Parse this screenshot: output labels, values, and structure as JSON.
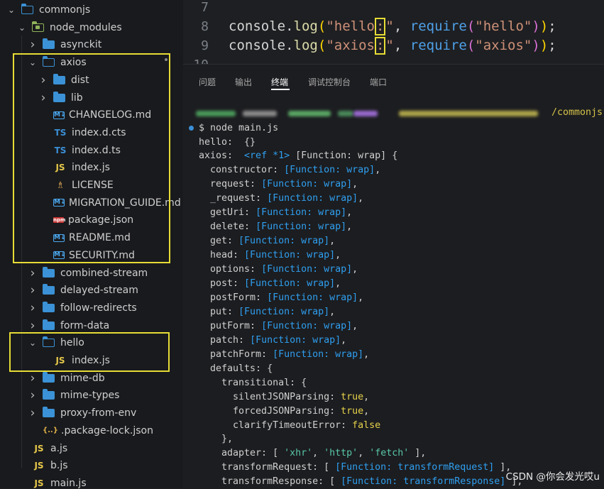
{
  "explorer": {
    "rows": [
      {
        "label": "commonjs",
        "kind": "folder-open",
        "depth": 0
      },
      {
        "label": "node_modules",
        "kind": "folder-nm",
        "depth": 1
      },
      {
        "label": "asynckit",
        "kind": "folder",
        "depth": 2
      },
      {
        "label": "axios",
        "kind": "folder-open",
        "depth": 2
      },
      {
        "label": "dist",
        "kind": "folder",
        "depth": 3
      },
      {
        "label": "lib",
        "kind": "folder",
        "depth": 3
      },
      {
        "label": "CHANGELOG.md",
        "kind": "md",
        "depth": 3
      },
      {
        "label": "index.d.cts",
        "kind": "ts",
        "depth": 3
      },
      {
        "label": "index.d.ts",
        "kind": "ts",
        "depth": 3
      },
      {
        "label": "index.js",
        "kind": "js",
        "depth": 3
      },
      {
        "label": "LICENSE",
        "kind": "license",
        "depth": 3
      },
      {
        "label": "MIGRATION_GUIDE.md",
        "kind": "md",
        "depth": 3
      },
      {
        "label": "package.json",
        "kind": "npm",
        "depth": 3
      },
      {
        "label": "README.md",
        "kind": "md",
        "depth": 3
      },
      {
        "label": "SECURITY.md",
        "kind": "md",
        "depth": 3
      },
      {
        "label": "combined-stream",
        "kind": "folder",
        "depth": 2
      },
      {
        "label": "delayed-stream",
        "kind": "folder",
        "depth": 2
      },
      {
        "label": "follow-redirects",
        "kind": "folder",
        "depth": 2
      },
      {
        "label": "form-data",
        "kind": "folder",
        "depth": 2
      },
      {
        "label": "hello",
        "kind": "folder-open",
        "depth": 2
      },
      {
        "label": "index.js",
        "kind": "js",
        "depth": 3
      },
      {
        "label": "mime-db",
        "kind": "folder",
        "depth": 2
      },
      {
        "label": "mime-types",
        "kind": "folder",
        "depth": 2
      },
      {
        "label": "proxy-from-env",
        "kind": "folder",
        "depth": 2
      },
      {
        "label": ".package-lock.json",
        "kind": "json",
        "depth": 2
      },
      {
        "label": "a.js",
        "kind": "js",
        "depth": 1
      },
      {
        "label": "b.js",
        "kind": "js",
        "depth": 1
      },
      {
        "label": "main.js",
        "kind": "js",
        "depth": 1
      }
    ],
    "icon_text": {
      "md": "M↓",
      "ts": "TS",
      "js": "JS",
      "npm": "npm",
      "license": "♗",
      "json": "{..}"
    }
  },
  "editor": {
    "lines": [
      {
        "n": "7",
        "tokens": []
      },
      {
        "n": "8",
        "tokens": [
          {
            "t": "console",
            "c": "tok-obj"
          },
          {
            "t": ".",
            "c": "tok-punc"
          },
          {
            "t": "log",
            "c": "tok-fn"
          },
          {
            "t": "(",
            "c": "tok-par1"
          },
          {
            "t": "\"hello",
            "c": "tok-str"
          },
          {
            "t": ": ",
            "c": "tok-str",
            "box": true
          },
          {
            "t": "\"",
            "c": "tok-str"
          },
          {
            "t": ", ",
            "c": "tok-punc"
          },
          {
            "t": "require",
            "c": "tok-req"
          },
          {
            "t": "(",
            "c": "tok-par2"
          },
          {
            "t": "\"hello\"",
            "c": "tok-str"
          },
          {
            "t": ")",
            "c": "tok-par2"
          },
          {
            "t": ")",
            "c": "tok-par1"
          },
          {
            "t": ";",
            "c": "tok-punc"
          }
        ]
      },
      {
        "n": "9",
        "tokens": [
          {
            "t": "console",
            "c": "tok-obj"
          },
          {
            "t": ".",
            "c": "tok-punc"
          },
          {
            "t": "log",
            "c": "tok-fn"
          },
          {
            "t": "(",
            "c": "tok-par1"
          },
          {
            "t": "\"axios",
            "c": "tok-str"
          },
          {
            "t": ": ",
            "c": "tok-str",
            "box": true
          },
          {
            "t": "\"",
            "c": "tok-str"
          },
          {
            "t": ", ",
            "c": "tok-punc"
          },
          {
            "t": "require",
            "c": "tok-req"
          },
          {
            "t": "(",
            "c": "tok-par2"
          },
          {
            "t": "\"axios\"",
            "c": "tok-str"
          },
          {
            "t": ")",
            "c": "tok-par2"
          },
          {
            "t": ")",
            "c": "tok-par1"
          },
          {
            "t": ";",
            "c": "tok-punc"
          }
        ]
      },
      {
        "n": "10",
        "tokens": []
      }
    ]
  },
  "panel": {
    "tabs": [
      "问题",
      "输出",
      "终端",
      "调试控制台",
      "端口"
    ],
    "active_tab": "终端",
    "path_suffix": "/commonjs",
    "command": "$ node main.js",
    "output": [
      [
        {
          "t": "hello:  {}",
          "c": "t-key"
        }
      ],
      [
        {
          "t": "axios:  ",
          "c": "t-key"
        },
        {
          "t": "<ref *1>",
          "c": "t-ref"
        },
        {
          "t": " [Function: wrap] {",
          "c": "t-punc"
        }
      ],
      [
        {
          "t": "  constructor: ",
          "c": "t-key"
        },
        {
          "t": "[Function: wrap]",
          "c": "t-fn"
        },
        {
          "t": ",",
          "c": "t-punc"
        }
      ],
      [
        {
          "t": "  request: ",
          "c": "t-key"
        },
        {
          "t": "[Function: wrap]",
          "c": "t-fn"
        },
        {
          "t": ",",
          "c": "t-punc"
        }
      ],
      [
        {
          "t": "  _request: ",
          "c": "t-key"
        },
        {
          "t": "[Function: wrap]",
          "c": "t-fn"
        },
        {
          "t": ",",
          "c": "t-punc"
        }
      ],
      [
        {
          "t": "  getUri: ",
          "c": "t-key"
        },
        {
          "t": "[Function: wrap]",
          "c": "t-fn"
        },
        {
          "t": ",",
          "c": "t-punc"
        }
      ],
      [
        {
          "t": "  delete: ",
          "c": "t-key"
        },
        {
          "t": "[Function: wrap]",
          "c": "t-fn"
        },
        {
          "t": ",",
          "c": "t-punc"
        }
      ],
      [
        {
          "t": "  get: ",
          "c": "t-key"
        },
        {
          "t": "[Function: wrap]",
          "c": "t-fn"
        },
        {
          "t": ",",
          "c": "t-punc"
        }
      ],
      [
        {
          "t": "  head: ",
          "c": "t-key"
        },
        {
          "t": "[Function: wrap]",
          "c": "t-fn"
        },
        {
          "t": ",",
          "c": "t-punc"
        }
      ],
      [
        {
          "t": "  options: ",
          "c": "t-key"
        },
        {
          "t": "[Function: wrap]",
          "c": "t-fn"
        },
        {
          "t": ",",
          "c": "t-punc"
        }
      ],
      [
        {
          "t": "  post: ",
          "c": "t-key"
        },
        {
          "t": "[Function: wrap]",
          "c": "t-fn"
        },
        {
          "t": ",",
          "c": "t-punc"
        }
      ],
      [
        {
          "t": "  postForm: ",
          "c": "t-key"
        },
        {
          "t": "[Function: wrap]",
          "c": "t-fn"
        },
        {
          "t": ",",
          "c": "t-punc"
        }
      ],
      [
        {
          "t": "  put: ",
          "c": "t-key"
        },
        {
          "t": "[Function: wrap]",
          "c": "t-fn"
        },
        {
          "t": ",",
          "c": "t-punc"
        }
      ],
      [
        {
          "t": "  putForm: ",
          "c": "t-key"
        },
        {
          "t": "[Function: wrap]",
          "c": "t-fn"
        },
        {
          "t": ",",
          "c": "t-punc"
        }
      ],
      [
        {
          "t": "  patch: ",
          "c": "t-key"
        },
        {
          "t": "[Function: wrap]",
          "c": "t-fn"
        },
        {
          "t": ",",
          "c": "t-punc"
        }
      ],
      [
        {
          "t": "  patchForm: ",
          "c": "t-key"
        },
        {
          "t": "[Function: wrap]",
          "c": "t-fn"
        },
        {
          "t": ",",
          "c": "t-punc"
        }
      ],
      [
        {
          "t": "  defaults: {",
          "c": "t-key"
        }
      ],
      [
        {
          "t": "    transitional: {",
          "c": "t-key"
        }
      ],
      [
        {
          "t": "      silentJSONParsing: ",
          "c": "t-key"
        },
        {
          "t": "true",
          "c": "t-bool"
        },
        {
          "t": ",",
          "c": "t-punc"
        }
      ],
      [
        {
          "t": "      forcedJSONParsing: ",
          "c": "t-key"
        },
        {
          "t": "true",
          "c": "t-bool"
        },
        {
          "t": ",",
          "c": "t-punc"
        }
      ],
      [
        {
          "t": "      clarifyTimeoutError: ",
          "c": "t-key"
        },
        {
          "t": "false",
          "c": "t-bool"
        }
      ],
      [
        {
          "t": "    },",
          "c": "t-punc"
        }
      ],
      [
        {
          "t": "    adapter: [ ",
          "c": "t-key"
        },
        {
          "t": "'xhr'",
          "c": "t-str"
        },
        {
          "t": ", ",
          "c": "t-punc"
        },
        {
          "t": "'http'",
          "c": "t-str"
        },
        {
          "t": ", ",
          "c": "t-punc"
        },
        {
          "t": "'fetch'",
          "c": "t-str"
        },
        {
          "t": " ],",
          "c": "t-punc"
        }
      ],
      [
        {
          "t": "    transformRequest: [ ",
          "c": "t-key"
        },
        {
          "t": "[Function: transformRequest]",
          "c": "t-fn"
        },
        {
          "t": " ],",
          "c": "t-punc"
        }
      ],
      [
        {
          "t": "    transformResponse: [ ",
          "c": "t-key"
        },
        {
          "t": "[Function: transformResponse]",
          "c": "t-fn"
        },
        {
          "t": " ],",
          "c": "t-punc"
        }
      ]
    ]
  },
  "watermark": "CSDN @你会发光哎u",
  "colors": {
    "highlight": "#e6dc35",
    "folder": "#3b92d6",
    "function": "#2f9ff0",
    "boolean": "#e5d14b"
  }
}
